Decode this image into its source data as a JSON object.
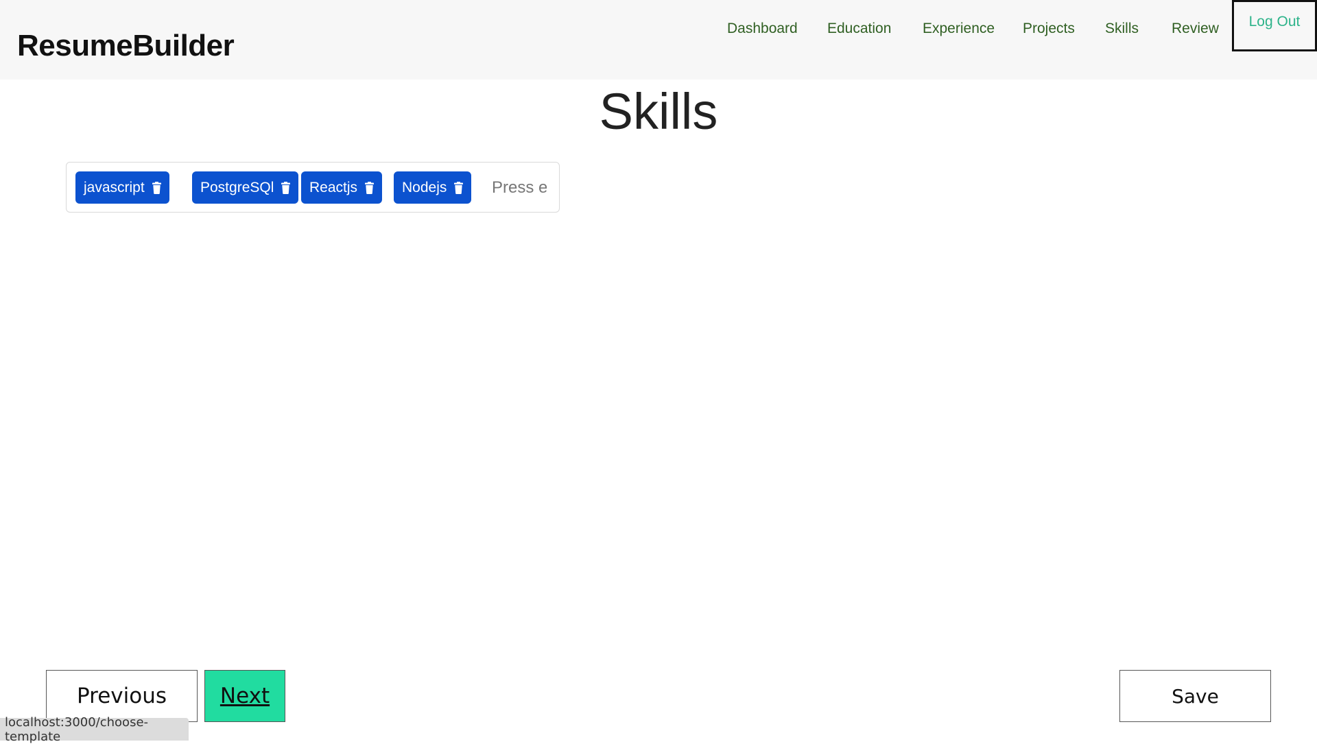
{
  "header": {
    "brand": "ResumeBuilder",
    "nav": [
      "Dashboard",
      "Education",
      "Experience",
      "Projects",
      "Skills",
      "Review"
    ],
    "logout": "Log Out"
  },
  "main": {
    "title": "Skills",
    "tags": [
      "javascript",
      "PostgreSQl",
      "Reactjs",
      "Nodejs"
    ],
    "input_placeholder": "Press enter to add skill"
  },
  "footer": {
    "previous": "Previous",
    "next": "Next",
    "save": "Save"
  },
  "status_bar": {
    "url": "localhost:3000/choose-template"
  },
  "colors": {
    "accent": "#21dca0",
    "tag_bg": "#0c52cf",
    "nav_text": "#2f5f22"
  }
}
